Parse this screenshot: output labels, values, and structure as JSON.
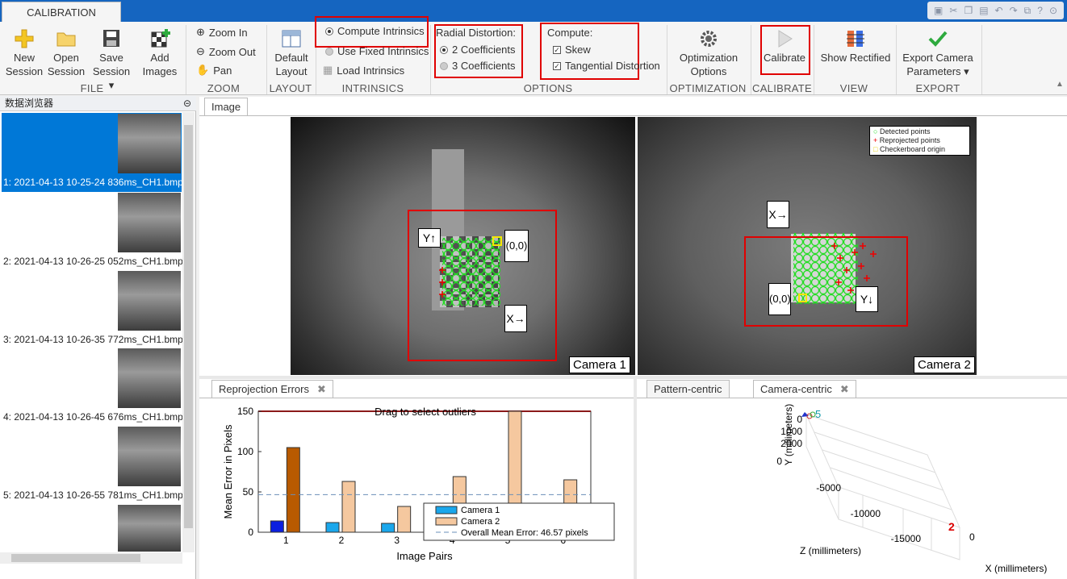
{
  "app": {
    "tab": "CALIBRATION",
    "browser_title": "数据浏览器"
  },
  "ribbon": {
    "file": {
      "label": "FILE",
      "new": [
        "New",
        "Session"
      ],
      "open": [
        "Open",
        "Session"
      ],
      "save": [
        "Save",
        "Session ▾"
      ],
      "add": [
        "Add",
        "Images"
      ]
    },
    "zoom": {
      "label": "ZOOM",
      "zoom_in": "Zoom In",
      "zoom_out": "Zoom Out",
      "pan": "Pan"
    },
    "layout": {
      "label": "LAYOUT",
      "default": [
        "Default",
        "Layout"
      ]
    },
    "intrinsics": {
      "label": "INTRINSICS",
      "compute": "Compute Intrinsics",
      "fixed": "Use Fixed Intrinsics",
      "load": "Load Intrinsics"
    },
    "options": {
      "label": "OPTIONS",
      "radial_title": "Radial Distortion:",
      "two": "2 Coefficients",
      "three": "3 Coefficients",
      "compute_title": "Compute:",
      "skew": "Skew",
      "tangential": "Tangential Distortion"
    },
    "optimization": {
      "label": "OPTIMIZATION",
      "btn": [
        "Optimization",
        "Options"
      ]
    },
    "calibrate": {
      "label": "CALIBRATE",
      "btn": "Calibrate"
    },
    "view": {
      "label": "VIEW",
      "btn": "Show Rectified"
    },
    "export": {
      "label": "EXPORT",
      "btn": [
        "Export Camera",
        "Parameters ▾"
      ]
    }
  },
  "browser": {
    "items": [
      {
        "label": "1: 2021-04-13 10-25-24 836ms_CH1.bmp",
        "selected": true
      },
      {
        "label": "2: 2021-04-13 10-26-25 052ms_CH1.bmp"
      },
      {
        "label": "3: 2021-04-13 10-26-35 772ms_CH1.bmp"
      },
      {
        "label": "4: 2021-04-13 10-26-45 676ms_CH1.bmp"
      },
      {
        "label": "5: 2021-04-13 10-26-55 781ms_CH1.bmp"
      }
    ]
  },
  "image_panel": {
    "tab": "Image",
    "cam1": "Camera 1",
    "cam2": "Camera 2",
    "legend": [
      "Detected points",
      "Reprojected points",
      "Checkerboard origin"
    ],
    "cam1_labels": {
      "y": "Y↑",
      "origin": "(0,0)",
      "x": "X→"
    },
    "cam2_labels": {
      "x": "X→",
      "origin": "(0,0)",
      "y": "Y↓"
    }
  },
  "reprojection": {
    "tab": "Reprojection Errors",
    "drag_hint": "Drag to select outliers"
  },
  "extrinsics": {
    "tab1": "Pattern-centric",
    "tab2": "Camera-centric",
    "xlabel": "X (millimeters)",
    "ylabel": "Y (millimeters)",
    "zlabel": "Z (millimeters)",
    "yticks": [
      "0",
      "1000",
      "2000"
    ],
    "zticks": [
      "0",
      "-5000",
      "-10000",
      "-15000"
    ],
    "xticks": [
      "0"
    ],
    "cam_marker": "2",
    "marker5": "5"
  },
  "chart_data": {
    "type": "bar",
    "categories": [
      "1",
      "2",
      "3",
      "4",
      "5",
      "6"
    ],
    "series": [
      {
        "name": "Camera 1",
        "values": [
          14,
          12,
          11,
          0,
          0,
          0
        ],
        "color": "#1aa7ec"
      },
      {
        "name": "Camera 2",
        "values": [
          105,
          63,
          32,
          69,
          150,
          65
        ],
        "color": "#f5c89f"
      }
    ],
    "overall_mean": 46.57,
    "mean_label": "Overall Mean Error: 46.57 pixels",
    "xlabel": "Image Pairs",
    "ylabel": "Mean Error in Pixels",
    "ylim": [
      0,
      150
    ],
    "yticks": [
      0,
      50,
      100,
      150
    ]
  }
}
